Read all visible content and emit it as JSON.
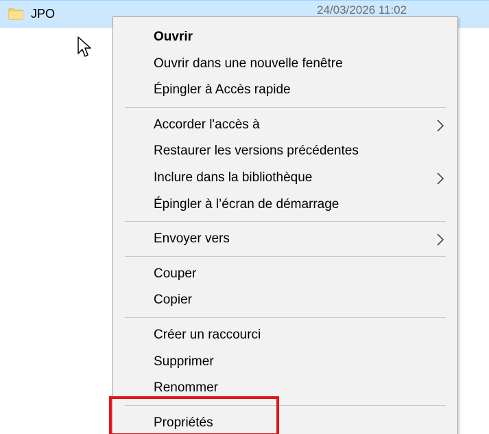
{
  "file": {
    "name": "JPO",
    "date": "24/03/2026 11:02",
    "icon": "folder-icon"
  },
  "menu": {
    "groups": [
      {
        "items": [
          {
            "label": "Ouvrir",
            "bold": true,
            "submenu": false
          },
          {
            "label": "Ouvrir dans une nouvelle fenêtre",
            "bold": false,
            "submenu": false
          },
          {
            "label": "Épingler à Accès rapide",
            "bold": false,
            "submenu": false
          }
        ]
      },
      {
        "items": [
          {
            "label": "Accorder l'accès à",
            "bold": false,
            "submenu": true
          },
          {
            "label": "Restaurer les versions précédentes",
            "bold": false,
            "submenu": false
          },
          {
            "label": "Inclure dans la bibliothèque",
            "bold": false,
            "submenu": true
          },
          {
            "label": "Épingler à l’écran de démarrage",
            "bold": false,
            "submenu": false
          }
        ]
      },
      {
        "items": [
          {
            "label": "Envoyer vers",
            "bold": false,
            "submenu": true
          }
        ]
      },
      {
        "items": [
          {
            "label": "Couper",
            "bold": false,
            "submenu": false
          },
          {
            "label": "Copier",
            "bold": false,
            "submenu": false
          }
        ]
      },
      {
        "items": [
          {
            "label": "Créer un raccourci",
            "bold": false,
            "submenu": false
          },
          {
            "label": "Supprimer",
            "bold": false,
            "submenu": false
          },
          {
            "label": "Renommer",
            "bold": false,
            "submenu": false
          }
        ]
      },
      {
        "items": [
          {
            "label": "Propriétés",
            "bold": false,
            "submenu": false,
            "highlighted": true
          }
        ]
      }
    ]
  },
  "colors": {
    "selection": "#cce8ff",
    "menu_bg": "#f2f2f2",
    "highlight_border": "#e4141b",
    "folder": "#f8d775"
  }
}
